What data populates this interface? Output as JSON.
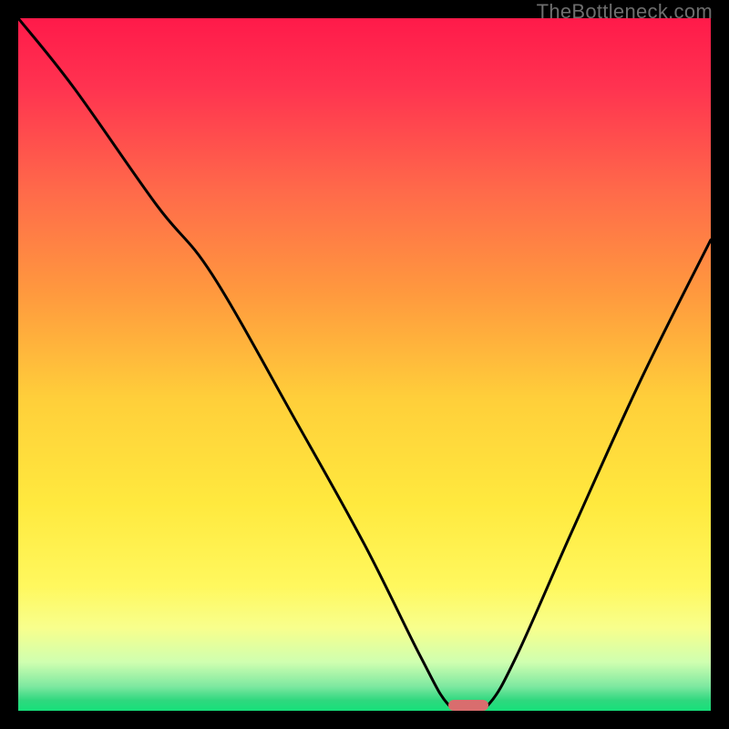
{
  "watermark": "TheBottleneck.com",
  "chart_data": {
    "type": "line",
    "title": "",
    "xlabel": "",
    "ylabel": "",
    "xlim": [
      0,
      100
    ],
    "ylim": [
      0,
      100
    ],
    "grid": false,
    "legend": false,
    "series": [
      {
        "name": "bottleneck-curve",
        "x": [
          0,
          8,
          20,
          28,
          40,
          50,
          58,
          62,
          65,
          68,
          72,
          80,
          90,
          100
        ],
        "values": [
          100,
          90,
          73,
          63,
          42,
          24,
          8,
          1,
          0,
          1,
          8,
          26,
          48,
          68
        ]
      }
    ],
    "annotations": [
      {
        "name": "optimal-marker",
        "shape": "rounded-rect",
        "x": 65,
        "y": 0,
        "color": "#d96d6e"
      }
    ],
    "background_gradient": {
      "type": "vertical",
      "stops": [
        {
          "offset": 0.0,
          "color": "#ff1a4a"
        },
        {
          "offset": 0.1,
          "color": "#ff3350"
        },
        {
          "offset": 0.25,
          "color": "#ff6a4a"
        },
        {
          "offset": 0.4,
          "color": "#ff9a3e"
        },
        {
          "offset": 0.55,
          "color": "#ffcf3a"
        },
        {
          "offset": 0.7,
          "color": "#ffe93e"
        },
        {
          "offset": 0.82,
          "color": "#fff85e"
        },
        {
          "offset": 0.88,
          "color": "#f8ff8c"
        },
        {
          "offset": 0.93,
          "color": "#cfffb0"
        },
        {
          "offset": 0.965,
          "color": "#7de8a0"
        },
        {
          "offset": 0.985,
          "color": "#2fd87e"
        },
        {
          "offset": 1.0,
          "color": "#16e07a"
        }
      ]
    }
  }
}
